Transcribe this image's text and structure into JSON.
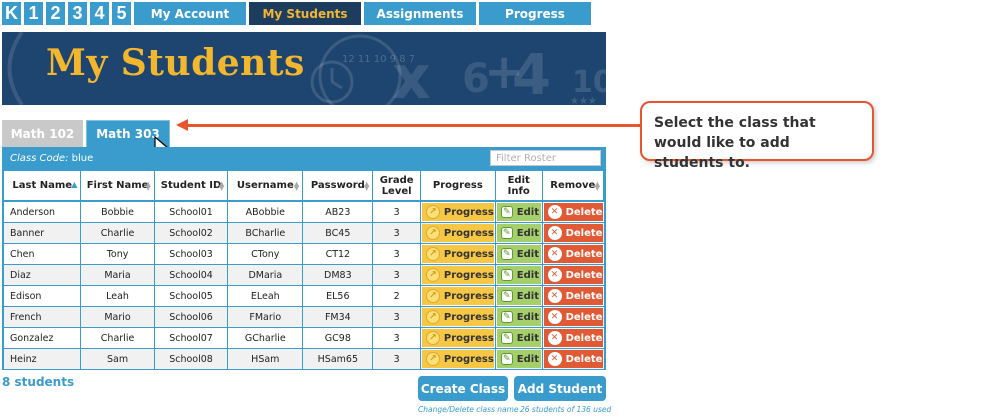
{
  "nav": {
    "grades": [
      "K",
      "1",
      "2",
      "3",
      "4",
      "5"
    ],
    "items": [
      {
        "label": "My Account"
      },
      {
        "label": "My Students"
      },
      {
        "label": "Assignments"
      },
      {
        "label": "Progress"
      }
    ]
  },
  "banner": {
    "title": "My Students"
  },
  "tabs": [
    {
      "label": "Math 102"
    },
    {
      "label": "Math 303"
    }
  ],
  "roster": {
    "class_code_label": "Class Code:",
    "class_code_value": "blue",
    "filter_placeholder": "Filter Roster",
    "headers": [
      "Last Name",
      "First Name",
      "Student ID",
      "Username",
      "Password",
      "Grade Level",
      "Progress",
      "Edit Info",
      "Remove"
    ],
    "rows": [
      {
        "last": "Anderson",
        "first": "Bobbie",
        "id": "School01",
        "username": "ABobbie",
        "password": "AB23",
        "grade": "3"
      },
      {
        "last": "Banner",
        "first": "Charlie",
        "id": "School02",
        "username": "BCharlie",
        "password": "BC45",
        "grade": "3"
      },
      {
        "last": "Chen",
        "first": "Tony",
        "id": "School03",
        "username": "CTony",
        "password": "CT12",
        "grade": "3"
      },
      {
        "last": "Diaz",
        "first": "Maria",
        "id": "School04",
        "username": "DMaria",
        "password": "DM83",
        "grade": "3"
      },
      {
        "last": "Edison",
        "first": "Leah",
        "id": "School05",
        "username": "ELeah",
        "password": "EL56",
        "grade": "2"
      },
      {
        "last": "French",
        "first": "Mario",
        "id": "School06",
        "username": "FMario",
        "password": "FM34",
        "grade": "3"
      },
      {
        "last": "Gonzalez",
        "first": "Charlie",
        "id": "School07",
        "username": "GCharlie",
        "password": "GC98",
        "grade": "3"
      },
      {
        "last": "Heinz",
        "first": "Sam",
        "id": "School08",
        "username": "HSam",
        "password": "HSam65",
        "grade": "3"
      }
    ],
    "progress_label": "Progress",
    "edit_label": "Edit",
    "delete_label": "Delete"
  },
  "footer": {
    "count": "8 students",
    "create_class": "Create Class",
    "add_student": "Add Student",
    "create_note": "Change/Delete class name",
    "add_note": "26 students of 136 used"
  },
  "callout": {
    "text": "Select the class that would like to add students to."
  },
  "colors": {
    "primary": "#3a9ccd",
    "navy": "#1d3d5e",
    "gold": "#f2b535",
    "accent": "#e7552c"
  }
}
